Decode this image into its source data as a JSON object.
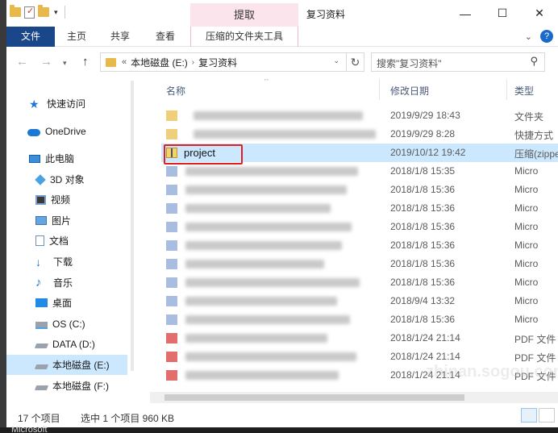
{
  "titlebar": {
    "tool_tab_header": "提取",
    "window_title": "复习资料",
    "minimize": "—",
    "maximize": "☐",
    "close": "✕"
  },
  "ribbon": {
    "tabs": [
      {
        "label": "文件"
      },
      {
        "label": "主页"
      },
      {
        "label": "共享"
      },
      {
        "label": "查看"
      },
      {
        "label": "压缩的文件夹工具"
      }
    ],
    "help": "?"
  },
  "address": {
    "segments": [
      "本地磁盘 (E:)",
      "复习资料"
    ],
    "search_placeholder": "搜索\"复习资料\""
  },
  "nav": {
    "items": [
      {
        "label": "快速访问",
        "icon": "star-icon"
      },
      {
        "label": "OneDrive",
        "icon": "cloud-icon"
      },
      {
        "label": "此电脑",
        "icon": "computer-icon"
      },
      {
        "label": "3D 对象",
        "icon": "cube-icon"
      },
      {
        "label": "视频",
        "icon": "video-icon"
      },
      {
        "label": "图片",
        "icon": "picture-icon"
      },
      {
        "label": "文档",
        "icon": "document-icon"
      },
      {
        "label": "下载",
        "icon": "download-icon"
      },
      {
        "label": "音乐",
        "icon": "music-icon"
      },
      {
        "label": "桌面",
        "icon": "desktop-icon"
      },
      {
        "label": "OS (C:)",
        "icon": "drive-icon"
      },
      {
        "label": "DATA (D:)",
        "icon": "drive-icon"
      },
      {
        "label": "本地磁盘 (E:)",
        "icon": "drive-icon",
        "selected": true
      },
      {
        "label": "本地磁盘 (F:)",
        "icon": "drive-icon"
      }
    ]
  },
  "columns": {
    "name": "名称",
    "date": "修改日期",
    "type": "类型"
  },
  "files": [
    {
      "name": "",
      "date": "2019/9/29 18:43",
      "type": "文件夹",
      "icon": "folder"
    },
    {
      "name": "",
      "date": "2019/9/29 8:28",
      "type": "快捷方式",
      "icon": "folder"
    },
    {
      "name": "project",
      "date": "2019/10/12 19:42",
      "type": "压缩(zipped)",
      "icon": "zip",
      "selected": true
    },
    {
      "name": "",
      "date": "2018/1/8 15:35",
      "type": "Micro",
      "icon": "word"
    },
    {
      "name": "",
      "date": "2018/1/8 15:36",
      "type": "Micro",
      "icon": "word"
    },
    {
      "name": "",
      "date": "2018/1/8 15:36",
      "type": "Micro",
      "icon": "word"
    },
    {
      "name": "",
      "date": "2018/1/8 15:36",
      "type": "Micro",
      "icon": "word"
    },
    {
      "name": "",
      "date": "2018/1/8 15:36",
      "type": "Micro",
      "icon": "word"
    },
    {
      "name": "",
      "date": "2018/1/8 15:36",
      "type": "Micro",
      "icon": "word"
    },
    {
      "name": "",
      "date": "2018/1/8 15:36",
      "type": "Micro",
      "icon": "word"
    },
    {
      "name": "",
      "date": "2018/9/4 13:32",
      "type": "Micro",
      "icon": "word"
    },
    {
      "name": "",
      "date": "2018/1/8 15:36",
      "type": "Micro",
      "icon": "word"
    },
    {
      "name": "",
      "date": "2018/1/24 21:14",
      "type": "PDF 文件",
      "icon": "pdf"
    },
    {
      "name": "",
      "date": "2018/1/24 21:14",
      "type": "PDF 文件",
      "icon": "pdf"
    },
    {
      "name": "",
      "date": "2018/1/24 21:14",
      "type": "PDF 文件",
      "icon": "pdf"
    }
  ],
  "status": {
    "count": "17 个项目",
    "selection": "选中 1 个项目  960 KB"
  },
  "taskbar_text": "Microsoft",
  "watermark": "zhinan.sogou.com"
}
